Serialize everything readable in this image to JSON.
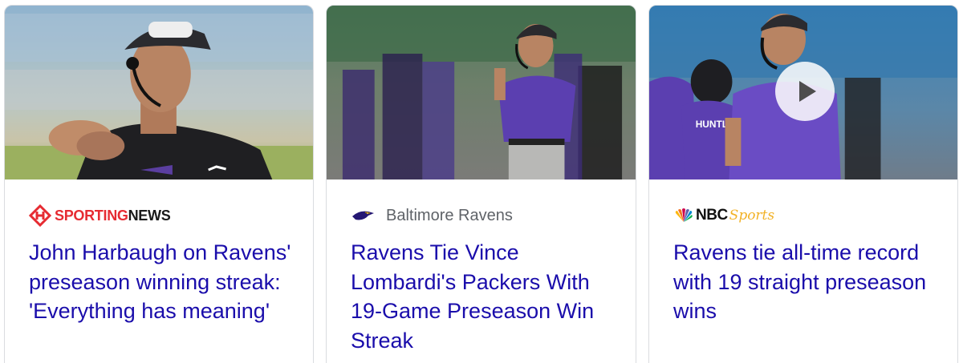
{
  "articles": [
    {
      "source": "SPORTINGNEWS",
      "source_logo": {
        "part1": "SPORTING",
        "part2": "NEWS",
        "color": "#e62b32"
      },
      "headline": "John Harbaugh on Ravens' preseason winning streak: 'Everything has meaning'",
      "thumbnail_icon": "coach-clapping-photo",
      "has_video": false
    },
    {
      "source": "Baltimore Ravens",
      "source_logo": {
        "icon": "ravens-bird-icon"
      },
      "headline": "Ravens Tie Vince Lombardi's Packers With 19-Game Preseason Win Streak",
      "thumbnail_icon": "coach-sideline-photo",
      "has_video": false
    },
    {
      "source": "NBCSports",
      "source_logo": {
        "part1": "NBC",
        "part2": "Sports",
        "color": "#f2b227"
      },
      "headline": "Ravens tie all-time record with 19 straight preseason wins",
      "thumbnail_icon": "coach-shouting-photo",
      "has_video": true,
      "video_icon": "play-icon"
    }
  ],
  "colors": {
    "headline": "#1a0dab",
    "source_text": "#5f6368",
    "card_border": "#dadce0",
    "ravens_purple": "#5b3fb0"
  }
}
